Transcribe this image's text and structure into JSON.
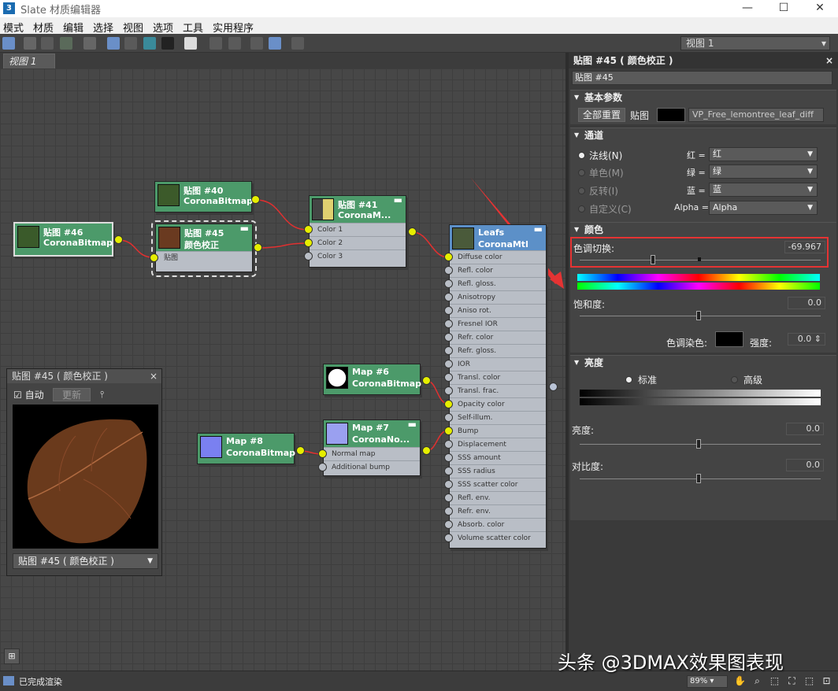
{
  "window": {
    "title": "Slate 材质编辑器",
    "app_icon": "3",
    "minimize": "—",
    "maximize": "☐",
    "close": "✕"
  },
  "menu": [
    "模式",
    "材质",
    "编辑",
    "选择",
    "视图",
    "选项",
    "工具",
    "实用程序"
  ],
  "toolbar": {
    "view_select": "视图 1"
  },
  "tabs": {
    "view1": "视图 1"
  },
  "nodes": {
    "n40": {
      "title": "贴图 #40",
      "type": "CoronaBitmap"
    },
    "n46": {
      "title": "贴图 #46",
      "type": "CoronaBitmap"
    },
    "n45": {
      "title": "贴图 #45",
      "type": "颜色校正",
      "slot": "贴图"
    },
    "n41": {
      "title": "贴图 #41",
      "type": "CoronaM...",
      "slots": [
        "Color 1",
        "Color 2",
        "Color 3"
      ]
    },
    "leafs": {
      "title": "Leafs",
      "type": "CoronaMtl",
      "slots": [
        "Diffuse color",
        "Refl. color",
        "Refl. gloss.",
        "Anisotropy",
        "Aniso rot.",
        "Fresnel IOR",
        "Refr. color",
        "Refr. gloss.",
        "IOR",
        "Transl. color",
        "Transl. frac.",
        "Opacity color",
        "Self-illum.",
        "Bump",
        "Displacement",
        "SSS amount",
        "SSS radius",
        "SSS scatter color",
        "Refl. env.",
        "Refr. env.",
        "Absorb. color",
        "Volume scatter color"
      ]
    },
    "n6": {
      "title": "Map #6",
      "type": "CoronaBitmap"
    },
    "n7": {
      "title": "Map #7",
      "type": "CoronaNo...",
      "slots": [
        "Normal map",
        "Additional bump"
      ]
    },
    "n8": {
      "title": "Map #8",
      "type": "CoronaBitmap"
    }
  },
  "preview": {
    "title": "贴图 #45 ( 颜色校正 )",
    "close": "×",
    "auto_label": "自动",
    "update_button": "更新",
    "select": "贴图 #45 ( 颜色校正 )",
    "auto_checked": true
  },
  "panel": {
    "title": "贴图 #45 ( 颜色校正 )",
    "close": "×",
    "name": "贴图 #45",
    "basic": {
      "header": "基本参数",
      "reset_button": "全部重置",
      "map_label": "贴图",
      "map_path": "VP_Free_lemontree_leaf_diff"
    },
    "channel": {
      "header": "通道",
      "options": [
        "法线(N)",
        "单色(M)",
        "反转(I)",
        "自定义(C)"
      ],
      "selected": 0,
      "rows": [
        {
          "label": "红 =",
          "value": "红"
        },
        {
          "label": "绿 =",
          "value": "绿"
        },
        {
          "label": "蓝 =",
          "value": "蓝"
        },
        {
          "label": "Alpha =",
          "value": "Alpha"
        }
      ]
    },
    "color": {
      "header": "颜色",
      "hue_label": "色调切换:",
      "hue_value": "-69.967",
      "saturation_label": "饱和度:",
      "saturation_value": "0.0",
      "tint_label": "色调染色:",
      "strength_label": "强度:",
      "strength_value": "0.0"
    },
    "brightness": {
      "header": "亮度",
      "modes": [
        "标准",
        "高级"
      ],
      "selected": 0,
      "brightness_label": "亮度:",
      "brightness_value": "0.0",
      "contrast_label": "对比度:",
      "contrast_value": "0.0"
    }
  },
  "status": {
    "text": "已完成渲染",
    "zoom": "89%"
  },
  "watermark": "头条 @3DMAX效果图表现",
  "colors": {
    "node_header": "#4c9a6a",
    "mtl_header": "#5c90c8",
    "socket": "#e6ee00",
    "wire": "#e03030",
    "highlight": "#e53333"
  }
}
